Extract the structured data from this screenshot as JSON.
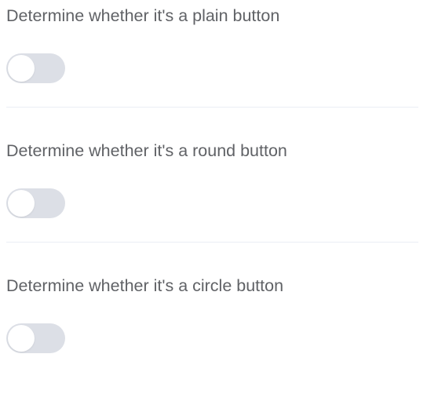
{
  "settings": [
    {
      "label": "Determine whether it's a plain button",
      "enabled": false
    },
    {
      "label": "Determine whether it's a round button",
      "enabled": false
    },
    {
      "label": "Determine whether it's a circle button",
      "enabled": false
    }
  ],
  "colors": {
    "label_text": "#606266",
    "switch_off": "#dcdfe6",
    "knob": "#ffffff",
    "divider": "#ebeef5"
  }
}
